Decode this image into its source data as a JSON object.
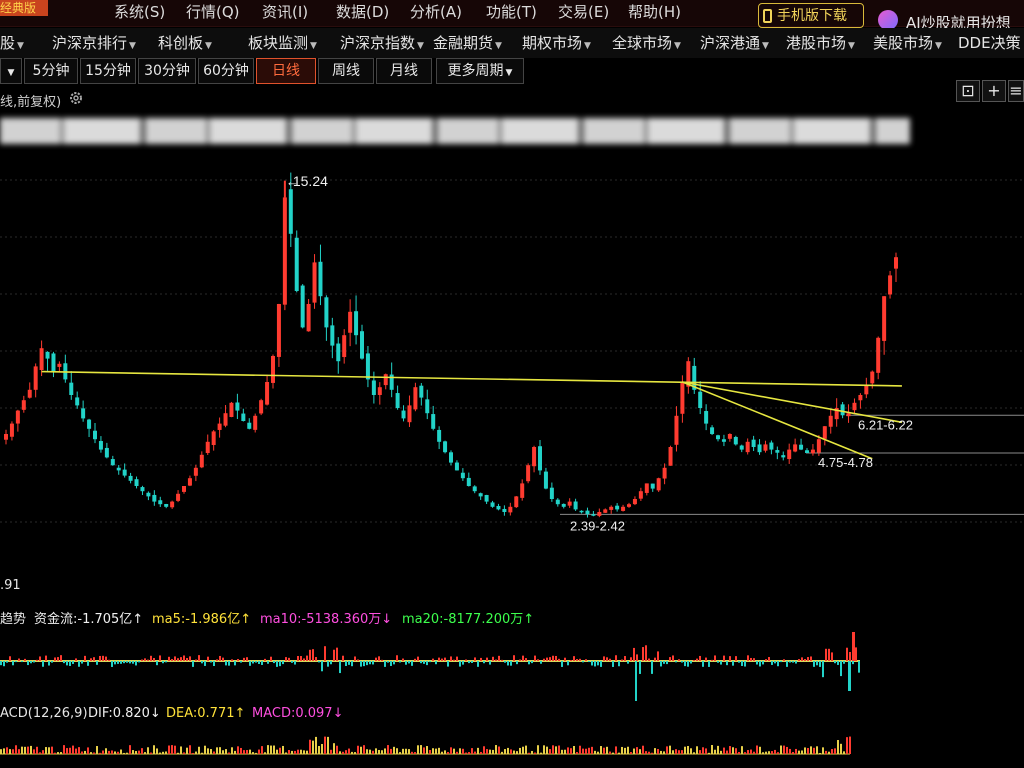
{
  "menu": {
    "logo_fragment": "经典版",
    "items": [
      "系统(S)",
      "行情(Q)",
      "资讯(I)",
      "数据(D)",
      "分析(A)",
      "功能(T)",
      "交易(E)",
      "帮助(H)"
    ],
    "mobile_button": "手机版下载",
    "ai_text": "AI炒股就用扮想"
  },
  "nav": {
    "items": [
      "股",
      "沪深京排行",
      "科创板",
      "板块监测",
      "沪深京指数",
      "金融期货",
      "期权市场",
      "全球市场",
      "沪深港通",
      "港股市场",
      "美股市场",
      "DDE决策"
    ]
  },
  "periods": {
    "items": [
      "",
      "5分钟",
      "15分钟",
      "30分钟",
      "60分钟",
      "日线",
      "周线",
      "月线",
      "更多周期"
    ],
    "active": "日线"
  },
  "controls": {
    "icons": [
      "lock-icon",
      "plus-icon",
      "menu-icon"
    ]
  },
  "chart": {
    "caption": "线,前复权)",
    "below_label": ".91",
    "annotations": {
      "high": "15.24",
      "level_1": "6.21-6.22",
      "level_2": "4.75-4.78",
      "level_3": "2.39-2.42"
    },
    "colors": {
      "up": "#ff3b30",
      "down": "#22d3c8",
      "trendline": "#e6e640",
      "signal": "#ff3322",
      "grid": "#2a2a2a"
    }
  },
  "chart_data": {
    "type": "candlestick",
    "series_name": "",
    "close_series": [
      5.5,
      5.9,
      6.4,
      6.8,
      7.2,
      8.1,
      8.8,
      8.4,
      7.9,
      8.2,
      7.6,
      7.0,
      6.6,
      6.1,
      5.7,
      5.3,
      4.9,
      4.6,
      4.3,
      4.1,
      3.9,
      3.7,
      3.5,
      3.3,
      3.1,
      2.9,
      2.8,
      2.7,
      2.9,
      3.2,
      3.5,
      3.8,
      4.2,
      4.7,
      5.2,
      5.6,
      5.9,
      6.3,
      6.7,
      6.4,
      6.0,
      5.7,
      6.2,
      6.8,
      7.5,
      8.5,
      10.5,
      14.6,
      13.2,
      11.0,
      9.6,
      10.5,
      12.1,
      10.8,
      9.6,
      8.9,
      8.3,
      9.3,
      10.2,
      9.3,
      8.4,
      7.6,
      7.0,
      7.3,
      7.8,
      7.2,
      6.5,
      6.1,
      6.6,
      7.3,
      6.9,
      6.3,
      5.7,
      5.2,
      4.8,
      4.4,
      4.1,
      3.8,
      3.5,
      3.3,
      3.1,
      2.9,
      2.7,
      2.6,
      2.5,
      2.7,
      3.1,
      3.6,
      4.3,
      5.0,
      4.1,
      3.4,
      3.0,
      2.8,
      2.7,
      2.9,
      2.6,
      2.5,
      2.42,
      2.4,
      2.5,
      2.6,
      2.7,
      2.6,
      2.7,
      2.8,
      3.0,
      3.3,
      3.6,
      3.4,
      3.8,
      4.2,
      5.0,
      6.2,
      7.5,
      8.3,
      7.2,
      6.5,
      5.9,
      5.5,
      5.3,
      5.2,
      5.5,
      5.1,
      4.9,
      5.2,
      5.0,
      4.8,
      5.1,
      4.9,
      4.78,
      4.6,
      4.9,
      5.1,
      4.9,
      4.77,
      4.9,
      5.3,
      5.8,
      6.2,
      6.5,
      6.22,
      6.3,
      6.7,
      7.0,
      7.4,
      7.9,
      9.2,
      10.8,
      11.6,
      12.3
    ],
    "high": 15.24,
    "annotations": [
      "15.24",
      "6.21-6.22",
      "4.75-4.78",
      "2.39-2.42"
    ],
    "ylim": [
      1.5,
      16.5
    ],
    "grid": true
  },
  "fund_flow": {
    "label_prefix": "趋势",
    "flow": "资金流:-1.705亿↑",
    "ma5": "ma5:-1.986亿↑",
    "ma10": "ma10:-5138.360万↓",
    "ma20": "ma20:-8177.200万↑"
  },
  "macd": {
    "label": "ACD(12,26,9)",
    "dif": "DIF:0.820↓",
    "dea": "DEA:0.771↑",
    "macd": "MACD:0.097↓"
  }
}
